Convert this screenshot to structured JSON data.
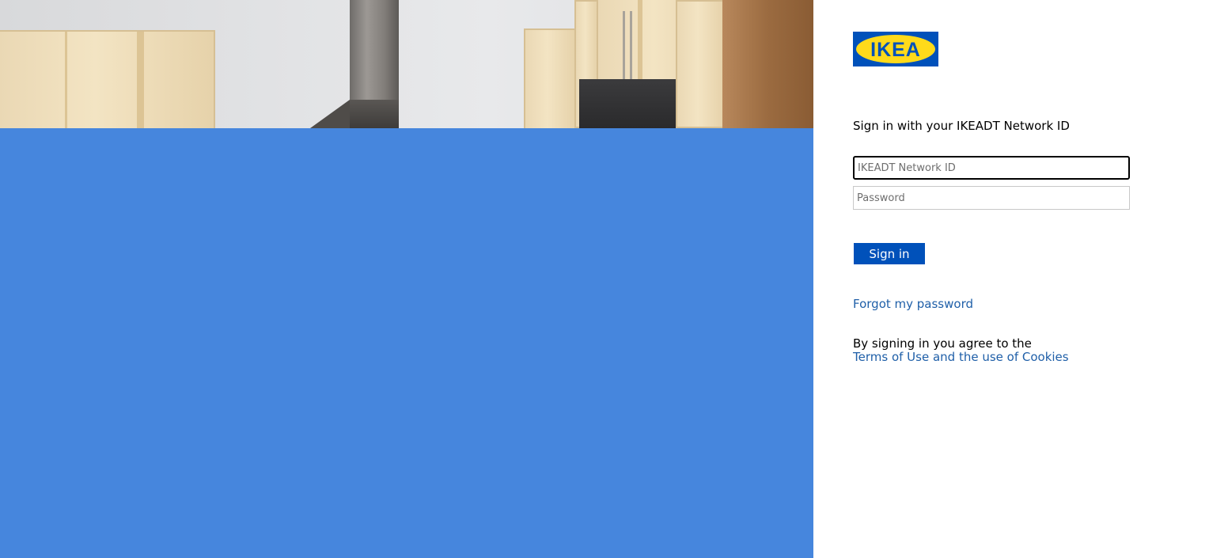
{
  "logo": {
    "text": "IKEA",
    "colors": {
      "background": "#0051ba",
      "oval": "#ffda1a",
      "text": "#0051ba"
    }
  },
  "signin": {
    "title": "Sign in with your IKEADT Network ID",
    "username_placeholder": "IKEADT Network ID",
    "username_value": "",
    "password_placeholder": "Password",
    "password_value": "",
    "submit_label": "Sign in",
    "forgot_password_label": "Forgot my password",
    "agreement_text": "By signing in you agree to the",
    "terms_link_label": "Terms of Use and the use of Cookies"
  },
  "illustration": {
    "background_color": "#4686dd",
    "image_description_icon": "kitchen-photo"
  },
  "colors": {
    "accent": "#0051ba",
    "link": "#1f5fa8"
  }
}
